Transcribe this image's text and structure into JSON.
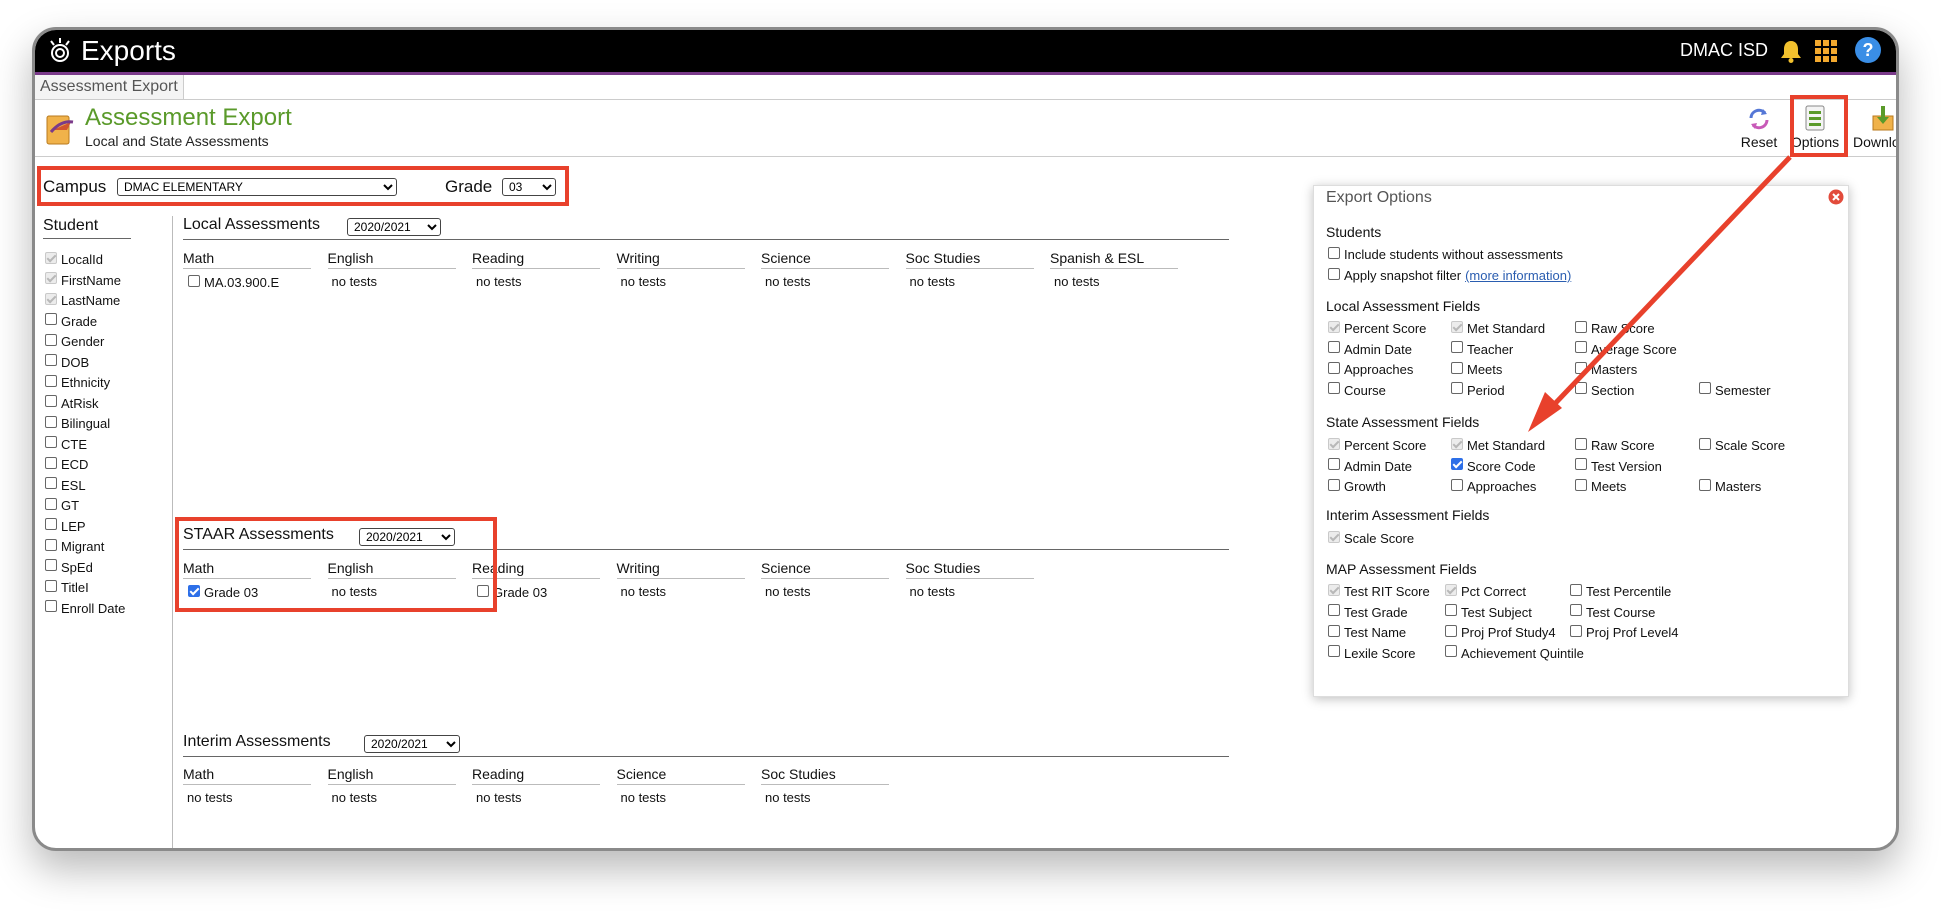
{
  "topbar": {
    "title": "Exports",
    "org": "DMAC ISD"
  },
  "tab": {
    "label": "Assessment Export"
  },
  "header": {
    "title": "Assessment Export",
    "subtitle": "Local and State Assessments",
    "reset": "Reset",
    "options": "Options",
    "download": "Download"
  },
  "filters": {
    "campus_label": "Campus",
    "campus_value": "DMAC ELEMENTARY",
    "grade_label": "Grade",
    "grade_value": "03"
  },
  "student": {
    "title": "Student",
    "items": [
      "LocalId",
      "FirstName",
      "LastName",
      "Grade",
      "Gender",
      "DOB",
      "Ethnicity",
      "AtRisk",
      "Bilingual",
      "CTE",
      "ECD",
      "ESL",
      "GT",
      "LEP",
      "Migrant",
      "SpEd",
      "TitleI",
      "Enroll Date"
    ]
  },
  "local": {
    "title": "Local Assessments",
    "year": "2020/2021",
    "columns": [
      "Math",
      "English",
      "Reading",
      "Writing",
      "Science",
      "Soc Studies",
      "Spanish & ESL"
    ],
    "values": [
      "MA.03.900.E",
      "no tests",
      "no tests",
      "no tests",
      "no tests",
      "no tests",
      "no tests"
    ]
  },
  "staar": {
    "title": "STAAR Assessments",
    "year": "2020/2021",
    "columns": [
      "Math",
      "English",
      "Reading",
      "Writing",
      "Science",
      "Soc Studies"
    ],
    "values": [
      "Grade 03",
      "no tests",
      "Grade 03",
      "no tests",
      "no tests",
      "no tests"
    ]
  },
  "interim": {
    "title": "Interim Assessments",
    "year": "2020/2021",
    "columns": [
      "Math",
      "English",
      "Reading",
      "Science",
      "Soc Studies"
    ],
    "values": [
      "no tests",
      "no tests",
      "no tests",
      "no tests",
      "no tests"
    ]
  },
  "options": {
    "title": "Export Options",
    "students_title": "Students",
    "students_items": [
      "Include students without assessments",
      "Apply snapshot filter"
    ],
    "more_info": "(more information)",
    "local_title": "Local Assessment Fields",
    "local_items": [
      "Percent Score",
      "Met Standard",
      "Raw Score",
      "Admin Date",
      "Teacher",
      "Average Score",
      "Approaches",
      "Meets",
      "Masters",
      "Course",
      "Period",
      "Section",
      "Semester"
    ],
    "state_title": "State Assessment Fields",
    "state_items": [
      "Percent Score",
      "Met Standard",
      "Raw Score",
      "Scale Score",
      "Admin Date",
      "Score Code",
      "Test Version",
      "Growth",
      "Approaches",
      "Meets",
      "Masters"
    ],
    "interim_title": "Interim Assessment Fields",
    "interim_items": [
      "Scale Score"
    ],
    "map_title": "MAP Assessment Fields",
    "map_items": [
      "Test RIT Score",
      "Pct Correct",
      "Test Percentile",
      "Test Grade",
      "Test Subject",
      "Test Course",
      "Test Name",
      "Proj Prof Study4",
      "Proj Prof Level4",
      "Lexile Score",
      "Achievement Quintile"
    ]
  },
  "colors": {
    "accent_green": "#5a9a2a",
    "annotation_red": "#e8412c",
    "checkbox_blue": "#2d6fe8"
  }
}
